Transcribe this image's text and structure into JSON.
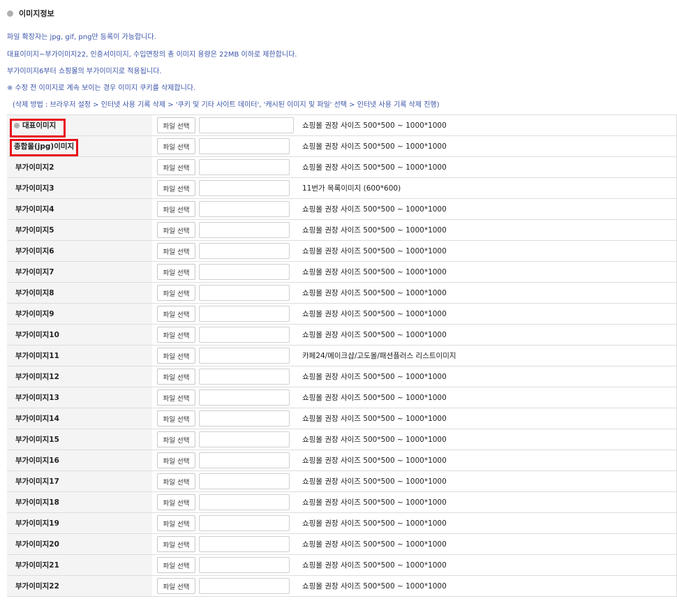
{
  "section": {
    "title": "이미지정보"
  },
  "notices": [
    "파일 확장자는 jpg, gif, png만 등록이 가능합니다.",
    "대표이미지~부가이미지22, 인증서이미지, 수입면장의 총 이미지 용량은 22MB 이하로 제한합니다.",
    "부가이미지6부터 쇼핑몰의 부가이미지로 적용됩니다.",
    "※ 수정 전 이미지로 계속 보이는 경우 이미지 쿠키를 삭제합니다.",
    "(삭제 방법 : 브라우저 설정 > 인터넷 사용 기록 삭제 > '쿠키 및 기타 사이트 데이터', '캐시된 이미지 및 파일' 선택 > 인터넷 사용 기록 삭제 진행)"
  ],
  "file_button_label": "파일 선택",
  "rows": [
    {
      "label": "대표이미지",
      "hint": "쇼핑몰 권장 사이즈 500*500 ~ 1000*1000"
    },
    {
      "label": "종합몰(jpg)이미지",
      "hint": "쇼핑몰 권장 사이즈 500*500 ~ 1000*1000"
    },
    {
      "label": "부가이미지2",
      "hint": "쇼핑몰 권장 사이즈 500*500 ~ 1000*1000"
    },
    {
      "label": "부가이미지3",
      "hint": "11번가 목록이미지 (600*600)"
    },
    {
      "label": "부가이미지4",
      "hint": "쇼핑몰 권장 사이즈 500*500 ~ 1000*1000"
    },
    {
      "label": "부가이미지5",
      "hint": "쇼핑몰 권장 사이즈 500*500 ~ 1000*1000"
    },
    {
      "label": "부가이미지6",
      "hint": "쇼핑몰 권장 사이즈 500*500 ~ 1000*1000"
    },
    {
      "label": "부가이미지7",
      "hint": "쇼핑몰 권장 사이즈 500*500 ~ 1000*1000"
    },
    {
      "label": "부가이미지8",
      "hint": "쇼핑몰 권장 사이즈 500*500 ~ 1000*1000"
    },
    {
      "label": "부가이미지9",
      "hint": "쇼핑몰 권장 사이즈 500*500 ~ 1000*1000"
    },
    {
      "label": "부가이미지10",
      "hint": "쇼핑몰 권장 사이즈 500*500 ~ 1000*1000"
    },
    {
      "label": "부가이미지11",
      "hint": "카페24/메이크샵/고도몰/패션플러스 리스트이미지"
    },
    {
      "label": "부가이미지12",
      "hint": "쇼핑몰 권장 사이즈 500*500 ~ 1000*1000"
    },
    {
      "label": "부가이미지13",
      "hint": "쇼핑몰 권장 사이즈 500*500 ~ 1000*1000"
    },
    {
      "label": "부가이미지14",
      "hint": "쇼핑몰 권장 사이즈 500*500 ~ 1000*1000"
    },
    {
      "label": "부가이미지15",
      "hint": "쇼핑몰 권장 사이즈 500*500 ~ 1000*1000"
    },
    {
      "label": "부가이미지16",
      "hint": "쇼핑몰 권장 사이즈 500*500 ~ 1000*1000"
    },
    {
      "label": "부가이미지17",
      "hint": "쇼핑몰 권장 사이즈 500*500 ~ 1000*1000"
    },
    {
      "label": "부가이미지18",
      "hint": "쇼핑몰 권장 사이즈 500*500 ~ 1000*1000"
    },
    {
      "label": "부가이미지19",
      "hint": "쇼핑몰 권장 사이즈 500*500 ~ 1000*1000"
    },
    {
      "label": "부가이미지20",
      "hint": "쇼핑몰 권장 사이즈 500*500 ~ 1000*1000"
    },
    {
      "label": "부가이미지21",
      "hint": "쇼핑몰 권장 사이즈 500*500 ~ 1000*1000"
    },
    {
      "label": "부가이미지22",
      "hint": "쇼핑몰 권장 사이즈 500*500 ~ 1000*1000"
    }
  ],
  "colors": {
    "notice_text": "#3b54a8",
    "highlight": "#e8101a",
    "label_bg": "#f4f4f4"
  }
}
